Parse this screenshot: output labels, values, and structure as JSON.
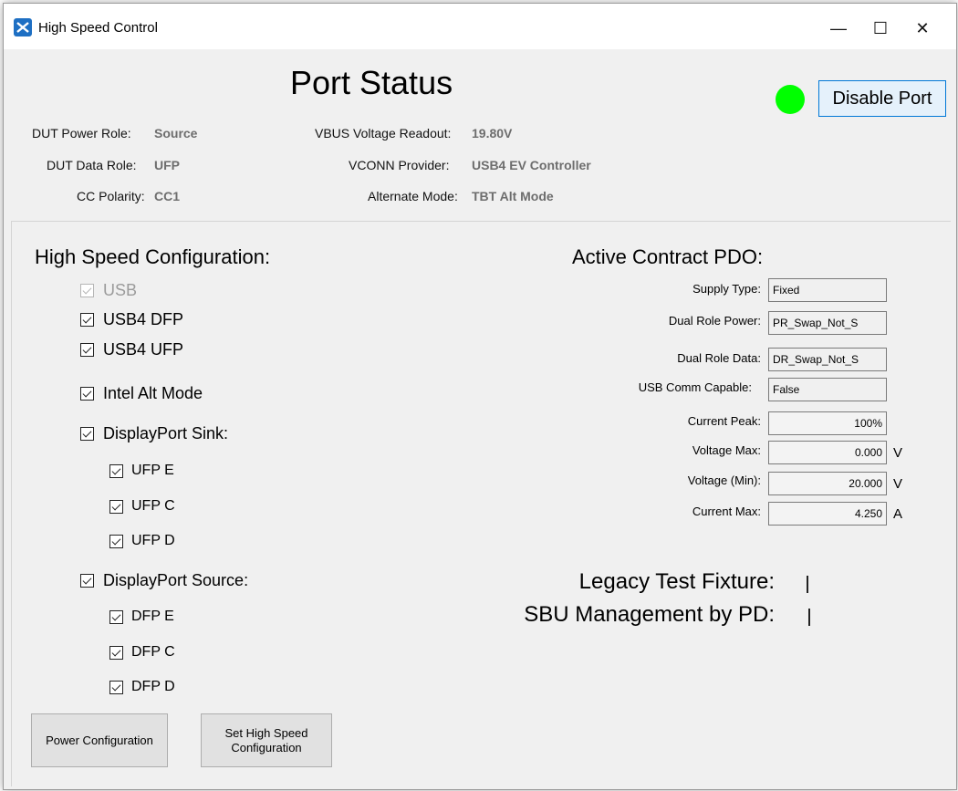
{
  "window": {
    "title": "High Speed Control",
    "minimize": "—",
    "maximize": "☐",
    "close": "✕"
  },
  "header": {
    "title": "Port Status",
    "disable_button": "Disable Port",
    "status_led_color": "#00ff00"
  },
  "status": {
    "power_role_label": "DUT Power Role:",
    "power_role_value": "Source",
    "data_role_label": "DUT Data Role:",
    "data_role_value": "UFP",
    "cc_polarity_label": "CC Polarity:",
    "cc_polarity_value": "CC1",
    "vbus_label": "VBUS Voltage Readout:",
    "vbus_value": "19.80V",
    "vconn_label": "VCONN Provider:",
    "vconn_value": "USB4 EV Controller",
    "alt_mode_label": "Alternate Mode:",
    "alt_mode_value": "TBT Alt Mode"
  },
  "hs_config": {
    "title": "High Speed Configuration:",
    "usb": {
      "label": "USB",
      "checked": true,
      "disabled": true
    },
    "usb4_dfp": {
      "label": "USB4 DFP",
      "checked": true
    },
    "usb4_ufp": {
      "label": "USB4 UFP",
      "checked": true
    },
    "intel_alt": {
      "label": "Intel Alt Mode",
      "checked": true
    },
    "dp_sink": {
      "label": "DisplayPort Sink:",
      "checked": true
    },
    "ufp_e": {
      "label": "UFP E",
      "checked": true
    },
    "ufp_c": {
      "label": "UFP C",
      "checked": true
    },
    "ufp_d": {
      "label": "UFP D",
      "checked": true
    },
    "dp_source": {
      "label": "DisplayPort Source:",
      "checked": true
    },
    "dfp_e": {
      "label": "DFP E",
      "checked": true
    },
    "dfp_c": {
      "label": "DFP C",
      "checked": true
    },
    "dfp_d": {
      "label": "DFP D",
      "checked": true
    }
  },
  "pdo": {
    "title": "Active Contract PDO:",
    "supply_type_label": "Supply Type:",
    "supply_type_value": "Fixed",
    "drp_label": "Dual Role Power:",
    "drp_value": "PR_Swap_Not_S",
    "drd_label": "Dual Role Data:",
    "drd_value": "DR_Swap_Not_S",
    "usb_comm_label": "USB Comm Capable:",
    "usb_comm_value": "False",
    "current_peak_label": "Current Peak:",
    "current_peak_value": "100%",
    "voltage_max_label": "Voltage Max:",
    "voltage_max_value": "0.000",
    "voltage_max_unit": "V",
    "voltage_min_label": "Voltage (Min):",
    "voltage_min_value": "20.000",
    "voltage_min_unit": "V",
    "current_max_label": "Current Max:",
    "current_max_value": "4.250",
    "current_max_unit": "A"
  },
  "options": {
    "legacy_label": "Legacy Test Fixture:",
    "legacy_checked": false,
    "sbu_label": "SBU Management by PD:",
    "sbu_checked": false
  },
  "buttons": {
    "power_config": "Power Configuration",
    "set_hs_config": "Set High Speed Configuration"
  }
}
